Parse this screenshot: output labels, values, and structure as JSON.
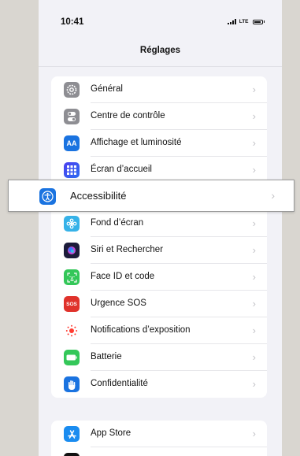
{
  "status_bar": {
    "time": "10:41",
    "network": "LTE"
  },
  "nav": {
    "title": "Réglages"
  },
  "settings_group": [
    {
      "label": "Général",
      "icon": "gear-icon",
      "color": "#8e8e93"
    },
    {
      "label": "Centre de contrôle",
      "icon": "toggle-icon",
      "color": "#8e8e93"
    },
    {
      "label": "Affichage et luminosité",
      "icon": "text-size-icon",
      "color": "#1a73e0",
      "glyph": "AA"
    },
    {
      "label": "Écran d’accueil",
      "icon": "home-grid-icon",
      "color": "#3a3ae0"
    },
    {
      "label": "Accessibilité",
      "icon": "accessibility-icon",
      "color": "#1a73e0"
    },
    {
      "label": "Fond d’écran",
      "icon": "wallpaper-icon",
      "color": "#36b2e8"
    },
    {
      "label": "Siri et Rechercher",
      "icon": "siri-icon",
      "color": "#1c1c3a"
    },
    {
      "label": "Face ID et code",
      "icon": "face-id-icon",
      "color": "#34c759"
    },
    {
      "label": "Urgence SOS",
      "icon": "sos-icon",
      "color": "#e0322b",
      "glyph": "SOS"
    },
    {
      "label": "Notifications d’exposition",
      "icon": "exposure-icon",
      "color": "#ffffff"
    },
    {
      "label": "Batterie",
      "icon": "battery-icon",
      "color": "#34c759"
    },
    {
      "label": "Confidentialité",
      "icon": "hand-icon",
      "color": "#1a73e0"
    }
  ],
  "store_group": [
    {
      "label": "App Store",
      "icon": "app-store-icon",
      "color": "#1a8cf0"
    }
  ]
}
